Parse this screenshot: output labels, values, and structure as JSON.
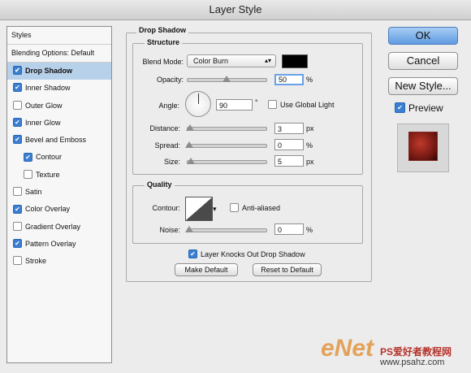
{
  "window": {
    "title": "Layer Style"
  },
  "style_list": {
    "header": "Styles",
    "blending_options": "Blending Options: Default",
    "items": [
      {
        "label": "Drop Shadow",
        "checked": true,
        "selected": true,
        "sub": false
      },
      {
        "label": "Inner Shadow",
        "checked": true,
        "selected": false,
        "sub": false
      },
      {
        "label": "Outer Glow",
        "checked": false,
        "selected": false,
        "sub": false
      },
      {
        "label": "Inner Glow",
        "checked": true,
        "selected": false,
        "sub": false
      },
      {
        "label": "Bevel and Emboss",
        "checked": true,
        "selected": false,
        "sub": false
      },
      {
        "label": "Contour",
        "checked": true,
        "selected": false,
        "sub": true
      },
      {
        "label": "Texture",
        "checked": false,
        "selected": false,
        "sub": true
      },
      {
        "label": "Satin",
        "checked": false,
        "selected": false,
        "sub": false
      },
      {
        "label": "Color Overlay",
        "checked": true,
        "selected": false,
        "sub": false
      },
      {
        "label": "Gradient Overlay",
        "checked": false,
        "selected": false,
        "sub": false
      },
      {
        "label": "Pattern Overlay",
        "checked": true,
        "selected": false,
        "sub": false
      },
      {
        "label": "Stroke",
        "checked": false,
        "selected": false,
        "sub": false
      }
    ]
  },
  "drop_shadow": {
    "title": "Drop Shadow",
    "structure": {
      "title": "Structure",
      "blend_mode_label": "Blend Mode:",
      "blend_mode_value": "Color Burn",
      "shadow_color": "#000000",
      "opacity_label": "Opacity:",
      "opacity_value": "50",
      "opacity_level": 0.5,
      "opacity_unit": "%",
      "angle_label": "Angle:",
      "angle_value": "90",
      "angle_unit": "°",
      "global_light_label": "Use Global Light",
      "global_light_checked": false,
      "distance_label": "Distance:",
      "distance_value": "3",
      "distance_unit": "px",
      "spread_label": "Spread:",
      "spread_value": "0",
      "spread_unit": "%",
      "size_label": "Size:",
      "size_value": "5",
      "size_unit": "px"
    },
    "quality": {
      "title": "Quality",
      "contour_label": "Contour:",
      "anti_aliased_label": "Anti-aliased",
      "anti_aliased_checked": false,
      "noise_label": "Noise:",
      "noise_value": "0",
      "noise_unit": "%"
    },
    "knocks_out_label": "Layer Knocks Out Drop Shadow",
    "knocks_out_checked": true,
    "make_default_label": "Make Default",
    "reset_default_label": "Reset to Default"
  },
  "buttons": {
    "ok": "OK",
    "cancel": "Cancel",
    "new_style": "New Style...",
    "preview_label": "Preview",
    "preview_checked": true
  },
  "watermark": {
    "logo_text": "eNet",
    "cn_text": "PS爱好者教程网",
    "url": "www.psahz.com"
  },
  "colors": {
    "selection": "#b8d1ea",
    "checkbox_on": "#3b7fd3",
    "default_button": "#5f9be0"
  }
}
